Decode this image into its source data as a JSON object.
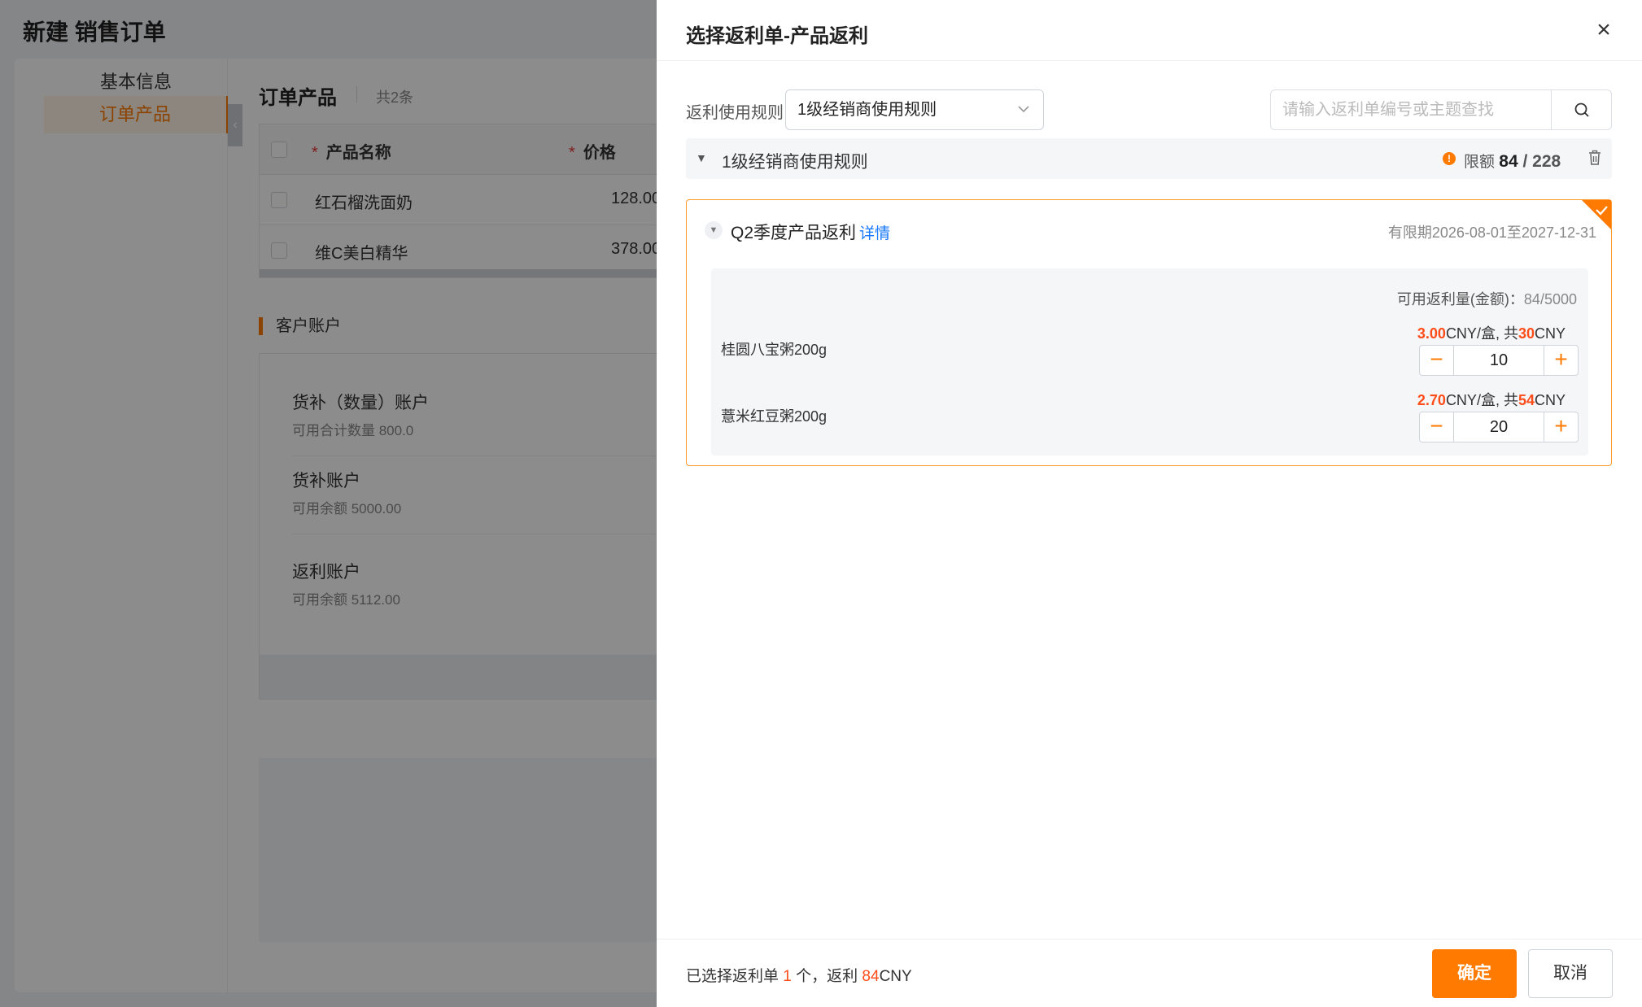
{
  "page": {
    "title": "新建 销售订单",
    "nav": [
      "基本信息",
      "订单产品"
    ],
    "products": {
      "title": "订单产品",
      "count": "共2条",
      "columns": [
        "产品名称",
        "价格"
      ],
      "rows": [
        {
          "name": "红石榴洗面奶",
          "price": "128.00"
        },
        {
          "name": "维C美白精华",
          "price": "378.00"
        }
      ]
    },
    "accounts": {
      "title": "客户账户",
      "items": [
        {
          "name": "货补（数量）账户",
          "sub": "可用合计数量 800.0"
        },
        {
          "name": "货补账户",
          "sub": "可用余额 5000.00"
        },
        {
          "name": "返利账户",
          "sub": "可用余额 5112.00"
        }
      ]
    }
  },
  "drawer": {
    "title": "选择返利单-产品返利",
    "close_glyph": "×",
    "rule_label": "返利使用规则",
    "rule_value": "1级经销商使用规则",
    "search_placeholder": "请输入返利单编号或主题查找",
    "group": {
      "name": "1级经销商使用规则",
      "quota_label": "限额",
      "quota_used": "84",
      "quota_sep": " / ",
      "quota_total": "228"
    },
    "rebate": {
      "title": "Q2季度产品返利",
      "detail_link": "详情",
      "validity": "有限期2026-08-01至2027-12-31",
      "avail_label": "可用返利量(金额)：",
      "avail_value": "84/5000",
      "items": [
        {
          "name": "桂圆八宝粥200g",
          "unit_price": "3.00",
          "unit_text": "CNY/盒, 共",
          "total": "30",
          "currency": "CNY",
          "qty": "10"
        },
        {
          "name": "薏米红豆粥200g",
          "unit_price": "2.70",
          "unit_text": "CNY/盒, 共",
          "total": "54",
          "currency": "CNY",
          "qty": "20"
        }
      ]
    },
    "footer": {
      "prefix": "已选择返利单 ",
      "count": "1",
      "middle": " 个，返利 ",
      "amount": "84",
      "currency": "CNY",
      "ok_label": "确定",
      "cancel_label": "取消"
    }
  },
  "colors": {
    "accent": "#ff7a00",
    "highlight": "#ff4d1a",
    "link": "#1677ff"
  }
}
